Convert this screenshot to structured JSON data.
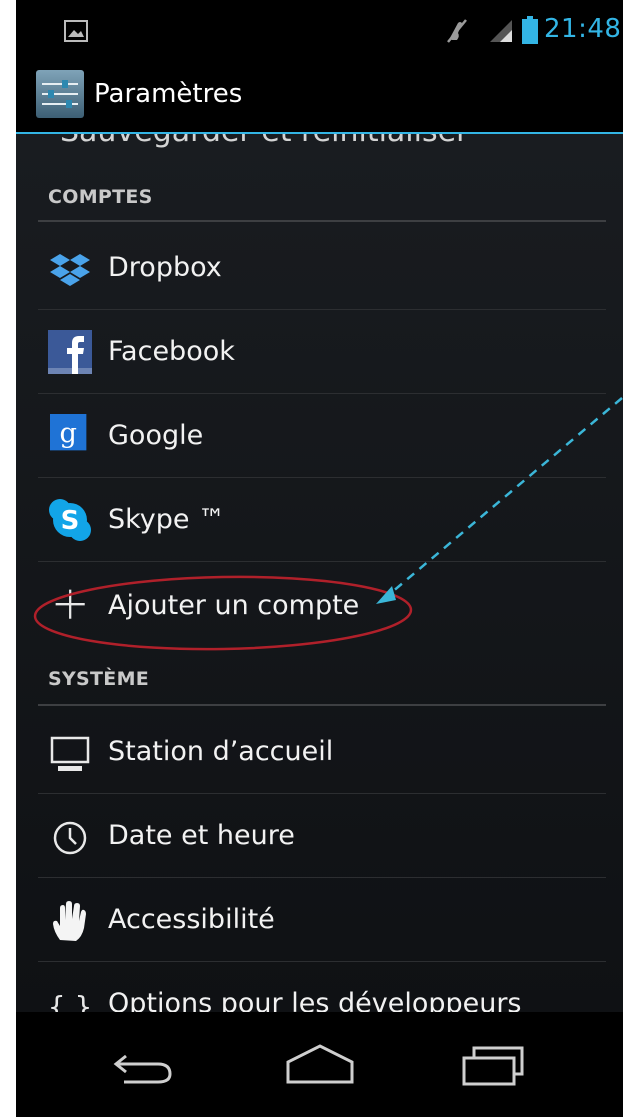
{
  "status_bar": {
    "time": "21:48",
    "icons": [
      "gallery-icon",
      "mute-icon",
      "signal-icon",
      "battery-icon"
    ]
  },
  "action_bar": {
    "title": "Paramètres",
    "icon": "settings-icon"
  },
  "partial_item": "Sauvegarder et réinitialiser",
  "sections": {
    "comptes": {
      "header": "COMPTES",
      "items": [
        {
          "label": "Dropbox",
          "icon": "dropbox-icon"
        },
        {
          "label": "Facebook",
          "icon": "facebook-icon"
        },
        {
          "label": "Google",
          "icon": "google-icon"
        },
        {
          "label": "Skype ™",
          "icon": "skype-icon"
        },
        {
          "label": "Ajouter un compte",
          "icon": "plus-icon"
        }
      ]
    },
    "systeme": {
      "header": "SYSTÈME",
      "items": [
        {
          "label": "Station d’accueil",
          "icon": "monitor-icon"
        },
        {
          "label": "Date et heure",
          "icon": "clock-icon"
        },
        {
          "label": "Accessibilité",
          "icon": "hand-icon"
        },
        {
          "label": "Options pour les développeurs",
          "icon": "braces-icon"
        }
      ]
    }
  },
  "nav_bar": {
    "buttons": [
      "back-icon",
      "home-icon",
      "recent-apps-icon"
    ]
  },
  "colors": {
    "accent": "#33b5e5",
    "annotation_circle": "#b0202a",
    "annotation_arrow": "#3bb6d8"
  }
}
